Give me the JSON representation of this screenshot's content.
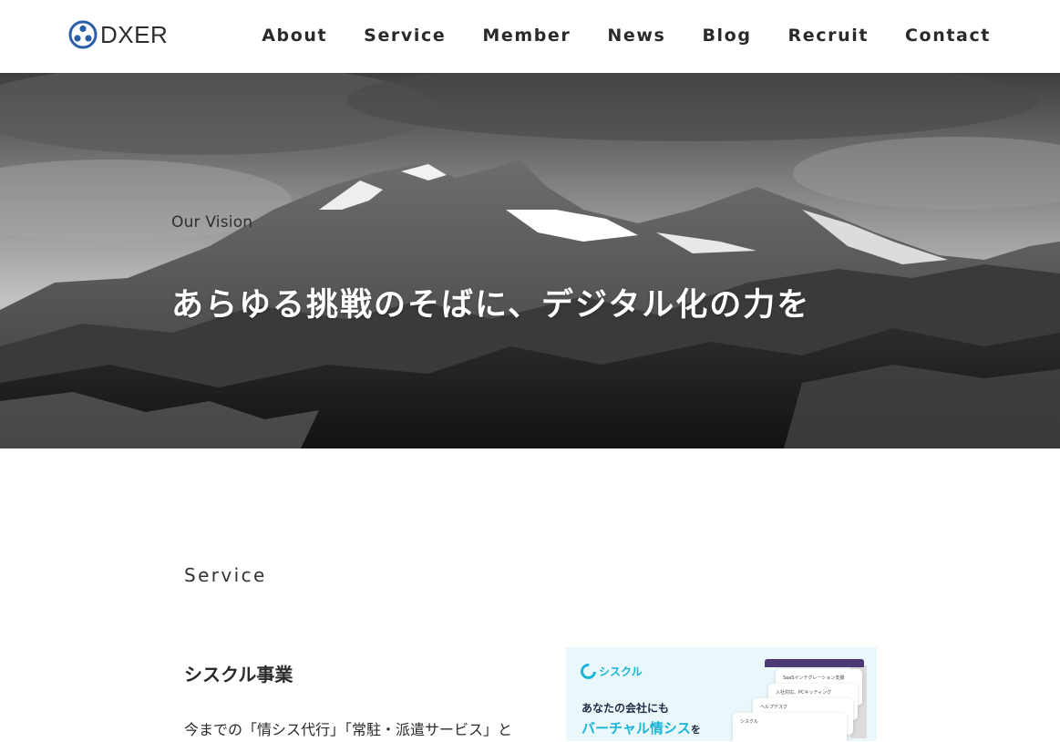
{
  "header": {
    "logo_text": "DXER",
    "nav": [
      "About",
      "Service",
      "Member",
      "News",
      "Blog",
      "Recruit",
      "Contact"
    ]
  },
  "hero": {
    "subtitle": "Our Vision",
    "title": "あらゆる挑戦のそばに、デジタル化の力を"
  },
  "service": {
    "heading": "Service",
    "name": "シスクル事業",
    "description": "今までの「情シス代行」「常駐・派遣サービス」と"
  },
  "card": {
    "brand": "シスクル",
    "line1": "あなたの会社にも",
    "line2": "バーチャル情シス",
    "line2_suffix": "を",
    "panels": [
      "SaaSインテグレーション支援",
      "入社対応、PCキッティング",
      "ヘルプデスク",
      "シスクル"
    ]
  },
  "colors": {
    "accent": "#19b4d6",
    "logo_blue": "#2b5ea7",
    "header_bg": "#ffffff",
    "text": "#2a2a2a"
  }
}
